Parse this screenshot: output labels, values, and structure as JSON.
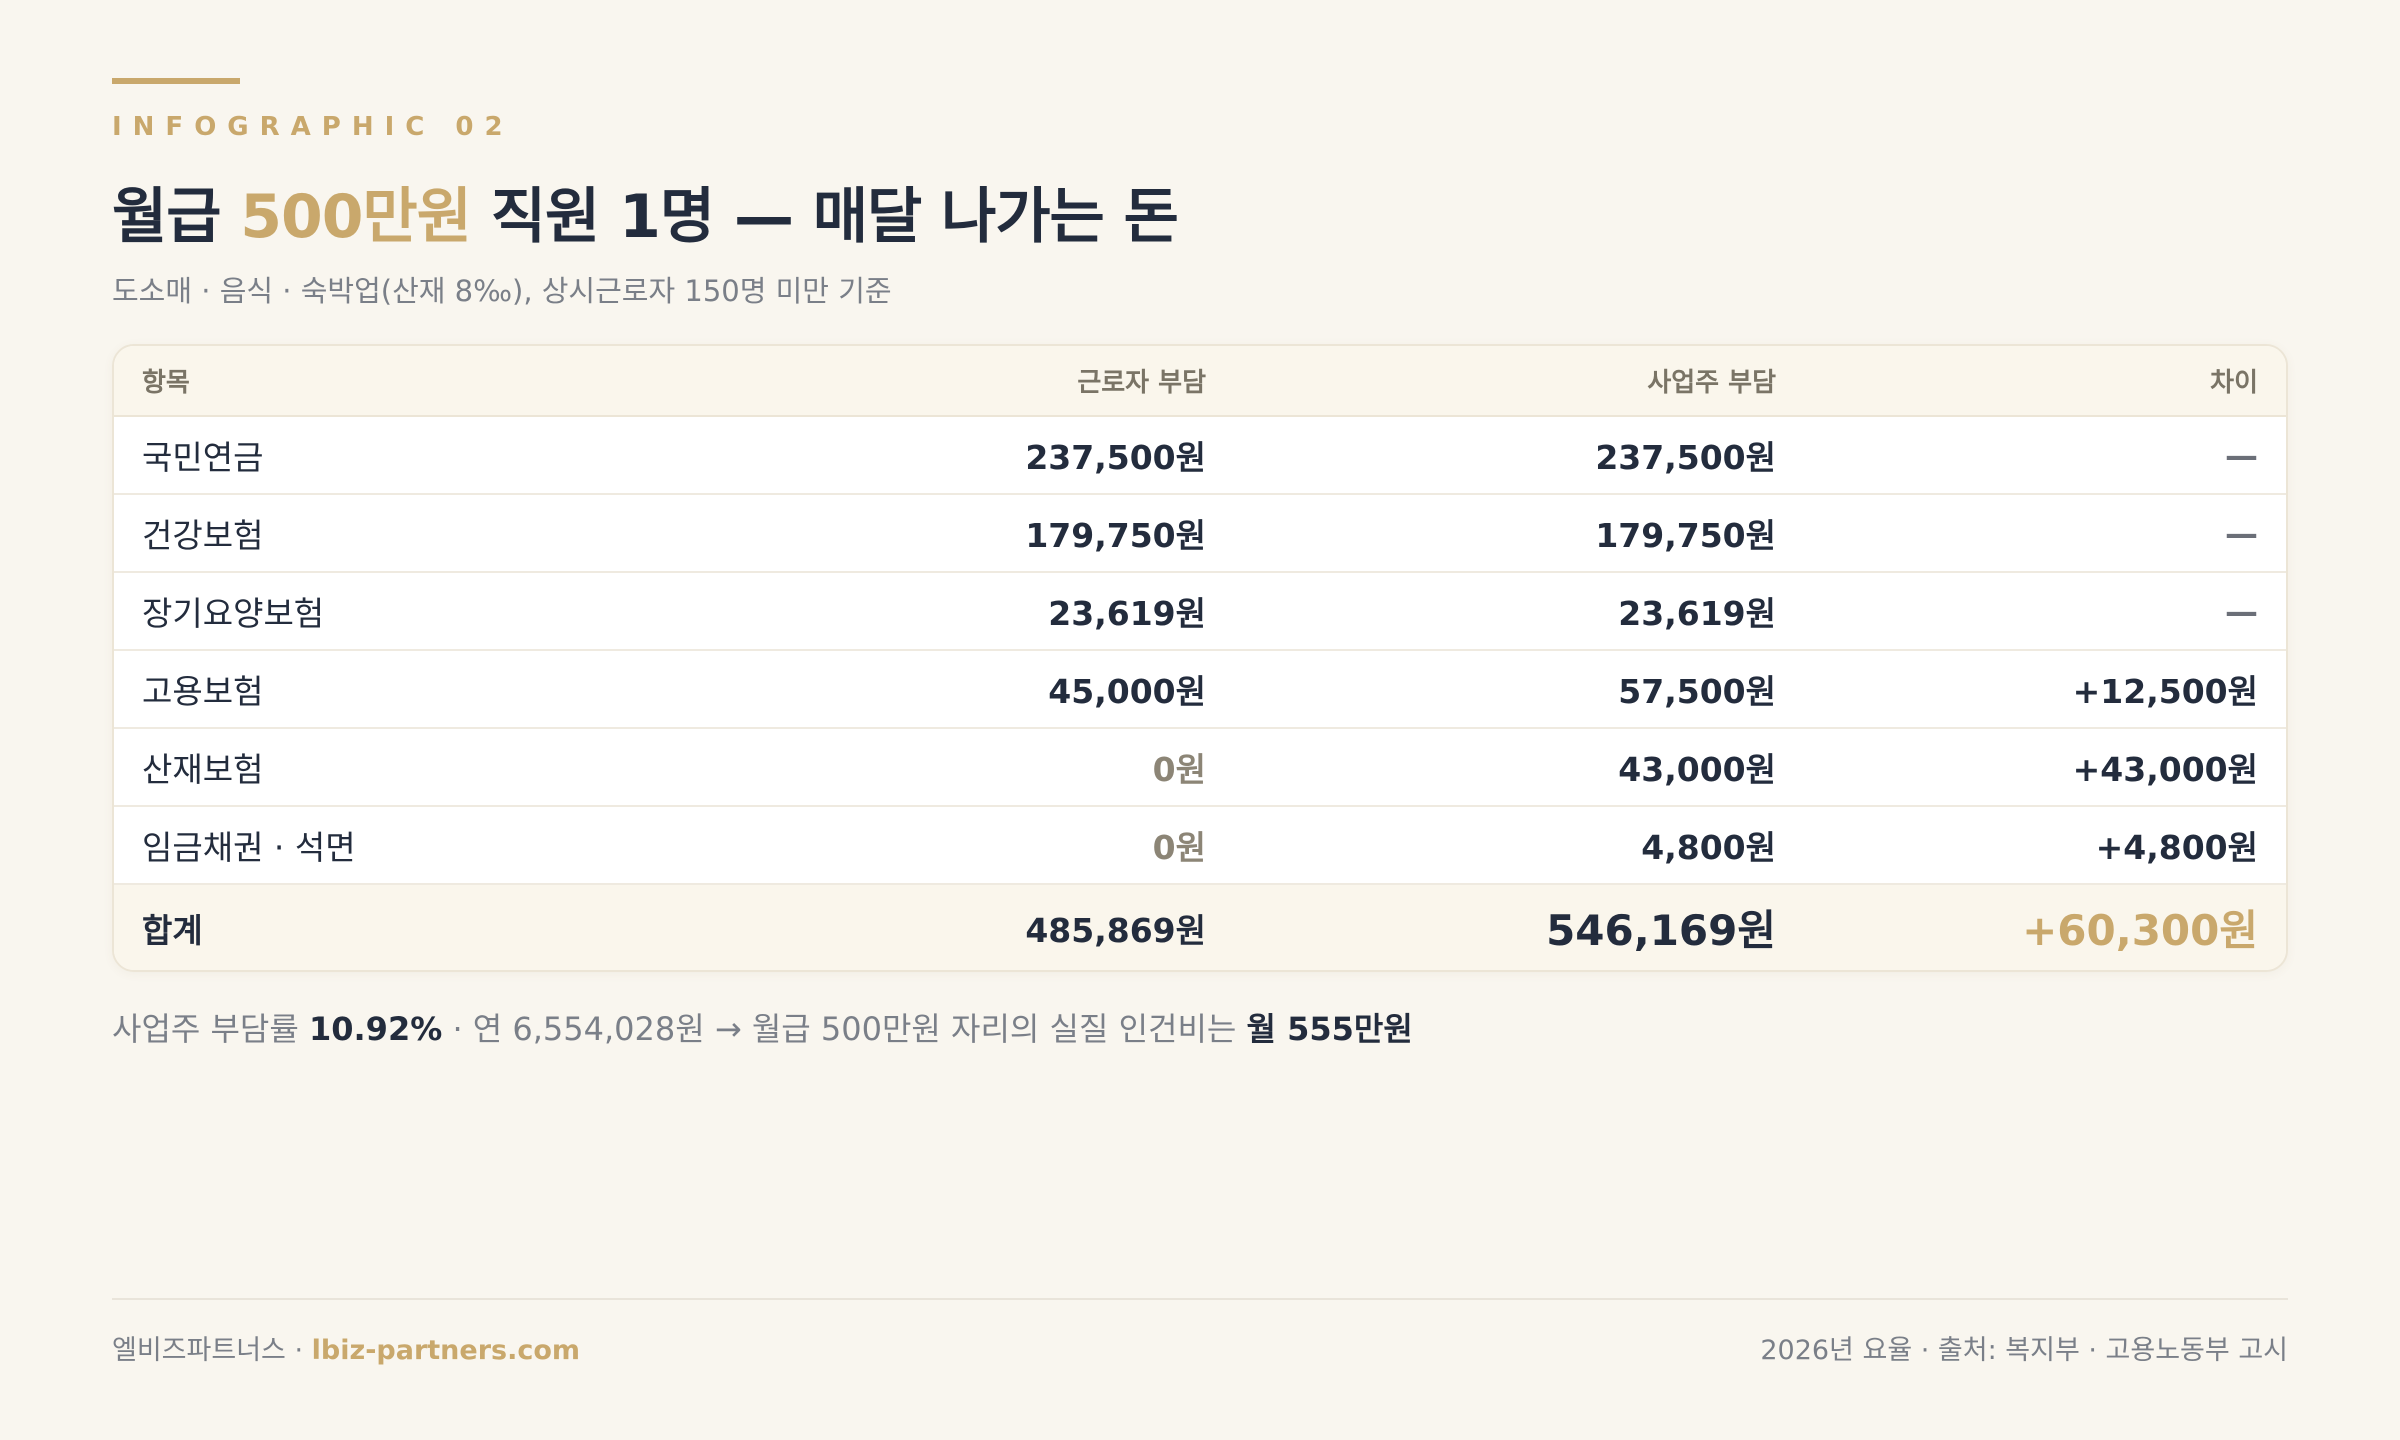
{
  "header": {
    "eyebrow": "INFOGRAPHIC 02",
    "title_part1": "월급 ",
    "title_highlight": "500만원",
    "title_part2": " 직원 1명 — 매달 나가는 돈",
    "subtitle": "도소매 · 음식 · 숙박업(산재 8‰), 상시근로자 150명 미만 기준"
  },
  "table": {
    "headers": [
      "항목",
      "근로자 부담",
      "사업주 부담",
      "차이"
    ],
    "rows": [
      {
        "item": "국민연금",
        "worker": "237,500원",
        "employer": "237,500원",
        "diff": "—"
      },
      {
        "item": "건강보험",
        "worker": "179,750원",
        "employer": "179,750원",
        "diff": "—"
      },
      {
        "item": "장기요양보험",
        "worker": "23,619원",
        "employer": "23,619원",
        "diff": "—"
      },
      {
        "item": "고용보험",
        "worker": "45,000원",
        "employer": "57,500원",
        "diff": "+12,500원"
      },
      {
        "item": "산재보험",
        "worker": "0원",
        "employer": "43,000원",
        "diff": "+43,000원"
      },
      {
        "item": "임금채권 · 석면",
        "worker": "0원",
        "employer": "4,800원",
        "diff": "+4,800원"
      }
    ],
    "total": {
      "item": "합계",
      "worker": "485,869원",
      "employer": "546,169원",
      "diff": "+60,300원"
    }
  },
  "summary": {
    "part1": "사업주 부담률 ",
    "rate": "10.92%",
    "part2": " · 연 6,554,028원 → 월급 500만원 자리의 실질 인건비는 ",
    "monthly": "월 555만원"
  },
  "footer": {
    "brand": "엘비즈파트너스 · ",
    "site": "lbiz-partners.com",
    "source": "2026년 요율 · 출처: 복지부 · 고용노동부 고시"
  },
  "colors": {
    "accent": "#c9a86c",
    "text": "#232c3d",
    "muted": "#7a7f88",
    "background": "#f9f6ef"
  }
}
